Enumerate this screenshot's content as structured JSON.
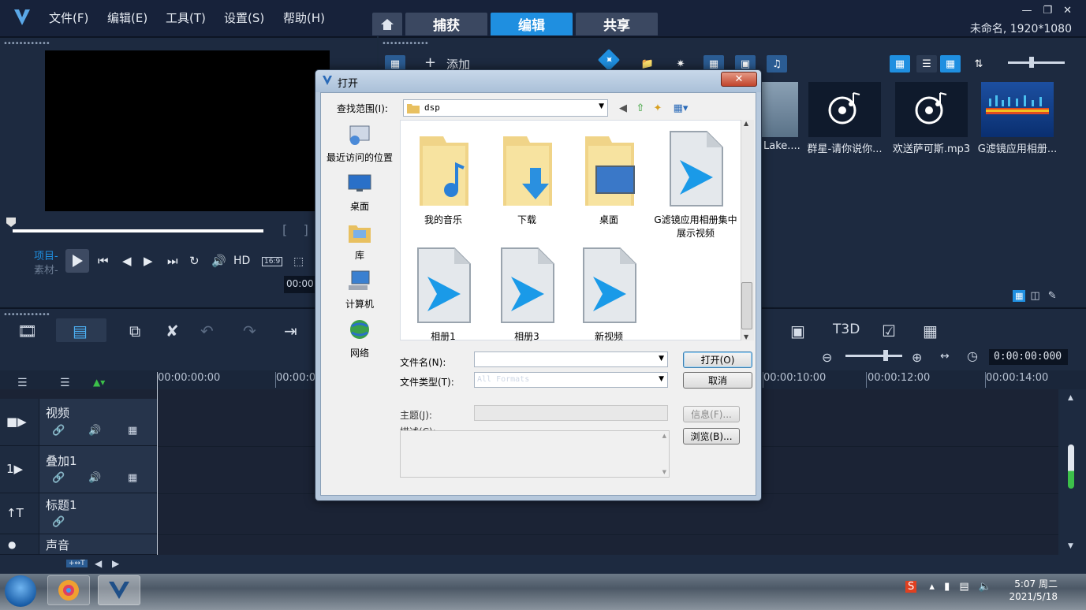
{
  "app": {
    "menu": [
      "文件(F)",
      "编辑(E)",
      "工具(T)",
      "设置(S)",
      "帮助(H)"
    ],
    "tabs": [
      "捕获",
      "编辑",
      "共享"
    ],
    "active_tab": "编辑",
    "project_name": "未命名, 1920*1080",
    "accent": "#1f8fe0"
  },
  "preview": {
    "mode_project": "项目-",
    "mode_clip": "素材-",
    "hd": "HD",
    "aspect": "16:9",
    "timecode": "00:00"
  },
  "library": {
    "add_label": "添加",
    "thumbnails": [
      {
        "caption": "Lake....",
        "icon": "image-thumb"
      },
      {
        "caption": "群星-请你说你...",
        "icon": "music-disc-icon"
      },
      {
        "caption": "欢送萨可斯.mp3",
        "icon": "music-disc-icon"
      },
      {
        "caption": "G滤镜应用相册...",
        "icon": "video-thumb"
      }
    ]
  },
  "timeline": {
    "timecode": "0:00:00:000",
    "ruler": [
      "00:00:00:00",
      "00:00:0",
      "00:00:10:00",
      "00:00:12:00",
      "00:00:14:00"
    ],
    "tracks": [
      {
        "name": "视频",
        "icon": "video-track-icon"
      },
      {
        "name": "叠加1",
        "icon": "overlay-track-icon"
      },
      {
        "name": "标题1",
        "icon": "title-track-icon"
      },
      {
        "name": "声音",
        "icon": "sound-track-icon"
      }
    ],
    "small_badge": "+↔T"
  },
  "dialog": {
    "title": "打开",
    "lookin_label": "查找范围(I):",
    "lookin_value": "dsp",
    "places": [
      "最近访问的位置",
      "桌面",
      "库",
      "计算机",
      "网络"
    ],
    "files": [
      {
        "name": "我的音乐",
        "type": "folder-music"
      },
      {
        "name": "下载",
        "type": "folder-download"
      },
      {
        "name": "桌面",
        "type": "folder-desktop"
      },
      {
        "name": "G滤镜应用相册集中展示视频",
        "type": "video-file"
      },
      {
        "name": "相册1",
        "type": "video-file"
      },
      {
        "name": "相册3",
        "type": "video-file"
      },
      {
        "name": "新视频",
        "type": "video-file"
      }
    ],
    "filename_label": "文件名(N):",
    "filename_value": "",
    "filetype_label": "文件类型(T):",
    "filetype_value": "All Formats",
    "open_button": "打开(O)",
    "cancel_button": "取消",
    "subject_label": "主题(J):",
    "desc_label": "描述(C):",
    "info_button": "信息(F)...",
    "browse_button": "浏览(B)..."
  },
  "taskbar": {
    "time": "5:07 周二",
    "date": "2021/5/18"
  }
}
